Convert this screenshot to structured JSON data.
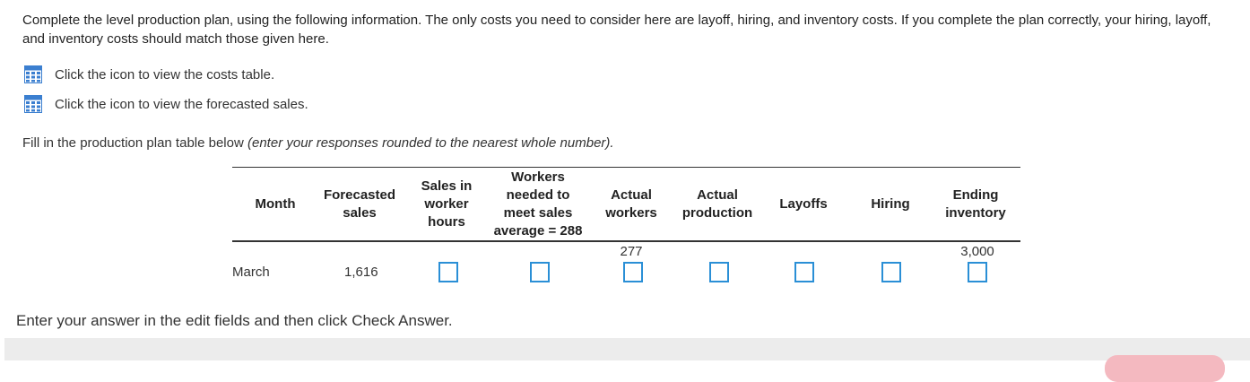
{
  "intro": "Complete the level production plan, using the following information. The only costs you need to consider here are layoff, hiring, and inventory costs. If you complete the plan correctly, your hiring, layoff, and inventory costs should match those given here.",
  "links": {
    "costs_table": "Click the icon to view the costs table.",
    "forecasted_sales": "Click the icon to view the forecasted sales.",
    "icon": "table-icon"
  },
  "instructions": {
    "main": "Fill in the production plan table below ",
    "note": "(enter your responses rounded to the nearest whole number)."
  },
  "table": {
    "headers": {
      "month": [
        "Month"
      ],
      "forecasted_sales": [
        "Forecasted",
        "sales"
      ],
      "sales_in_worker_hours": [
        "Sales in",
        "worker",
        "hours"
      ],
      "workers_needed": [
        "Workers",
        "needed to",
        "meet sales",
        "average = 288"
      ],
      "actual_workers": [
        "Actual",
        "workers"
      ],
      "actual_production": [
        "Actual",
        "production"
      ],
      "layoffs": [
        "Layoffs"
      ],
      "hiring": [
        "Hiring"
      ],
      "ending_inventory": [
        "Ending",
        "inventory"
      ]
    },
    "prior_values": {
      "actual_workers": "277",
      "ending_inventory": "3,000"
    },
    "row": {
      "month": "March",
      "forecasted_sales": "1,616"
    }
  },
  "footer": {
    "prompt": "Enter your answer in the edit fields and then click Check Answer."
  },
  "colors": {
    "input_border": "#2a8fd6",
    "icon_blue": "#3b7fd0",
    "footer_bar": "#ececec",
    "check_button": "#f4b9c0"
  }
}
